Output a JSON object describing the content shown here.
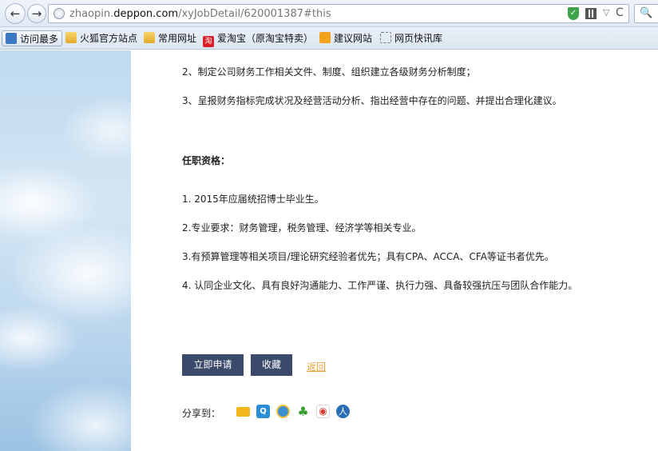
{
  "browser": {
    "url_prefix": "zhaopin.",
    "url_domain": "deppon.com",
    "url_path": "/xyJobDetail/620001387#this",
    "back_glyph": "←",
    "forward_glyph": "→",
    "dropdown_glyph": "▽",
    "reload_glyph": "C",
    "search_glyph": "🔍"
  },
  "bookmarks": [
    {
      "label": "访问最多",
      "icon": "bookmark-most-icon"
    },
    {
      "label": "火狐官方站点",
      "icon": "folder-icon"
    },
    {
      "label": "常用网址",
      "icon": "folder-icon"
    },
    {
      "label": "爱淘宝（原淘宝特卖）",
      "icon": "taobao-icon",
      "icon_text": "淘"
    },
    {
      "label": "建议网站",
      "icon": "bulb-icon"
    },
    {
      "label": "网页快讯库",
      "icon": "web-slice-icon"
    }
  ],
  "duties": [
    "2、制定公司财务工作相关文件、制度、组织建立各级财务分析制度；",
    "3、呈报财务指标完成状况及经营活动分析、指出经营中存在的问题、并提出合理化建议。"
  ],
  "requirements_title": "任职资格：",
  "requirements": [
    "1. 2015年应届统招博士毕业生。",
    "2.专业要求：财务管理，税务管理、经济学等相关专业。",
    "3.有预算管理等相关项目/理论研究经验者优先；具有CPA、ACCA、CFA等证书者优先。",
    "4. 认同企业文化、具有良好沟通能力、工作严谨、执行力强、具备较强抗压与团队合作能力。"
  ],
  "actions": {
    "apply": "立即申请",
    "favorite": "收藏",
    "back": "返回"
  },
  "share": {
    "label": "分享到：",
    "icons": [
      "mail-icon",
      "qzone-icon",
      "pengyou-icon",
      "kaixin-icon",
      "weibo-icon",
      "renren-icon"
    ]
  }
}
